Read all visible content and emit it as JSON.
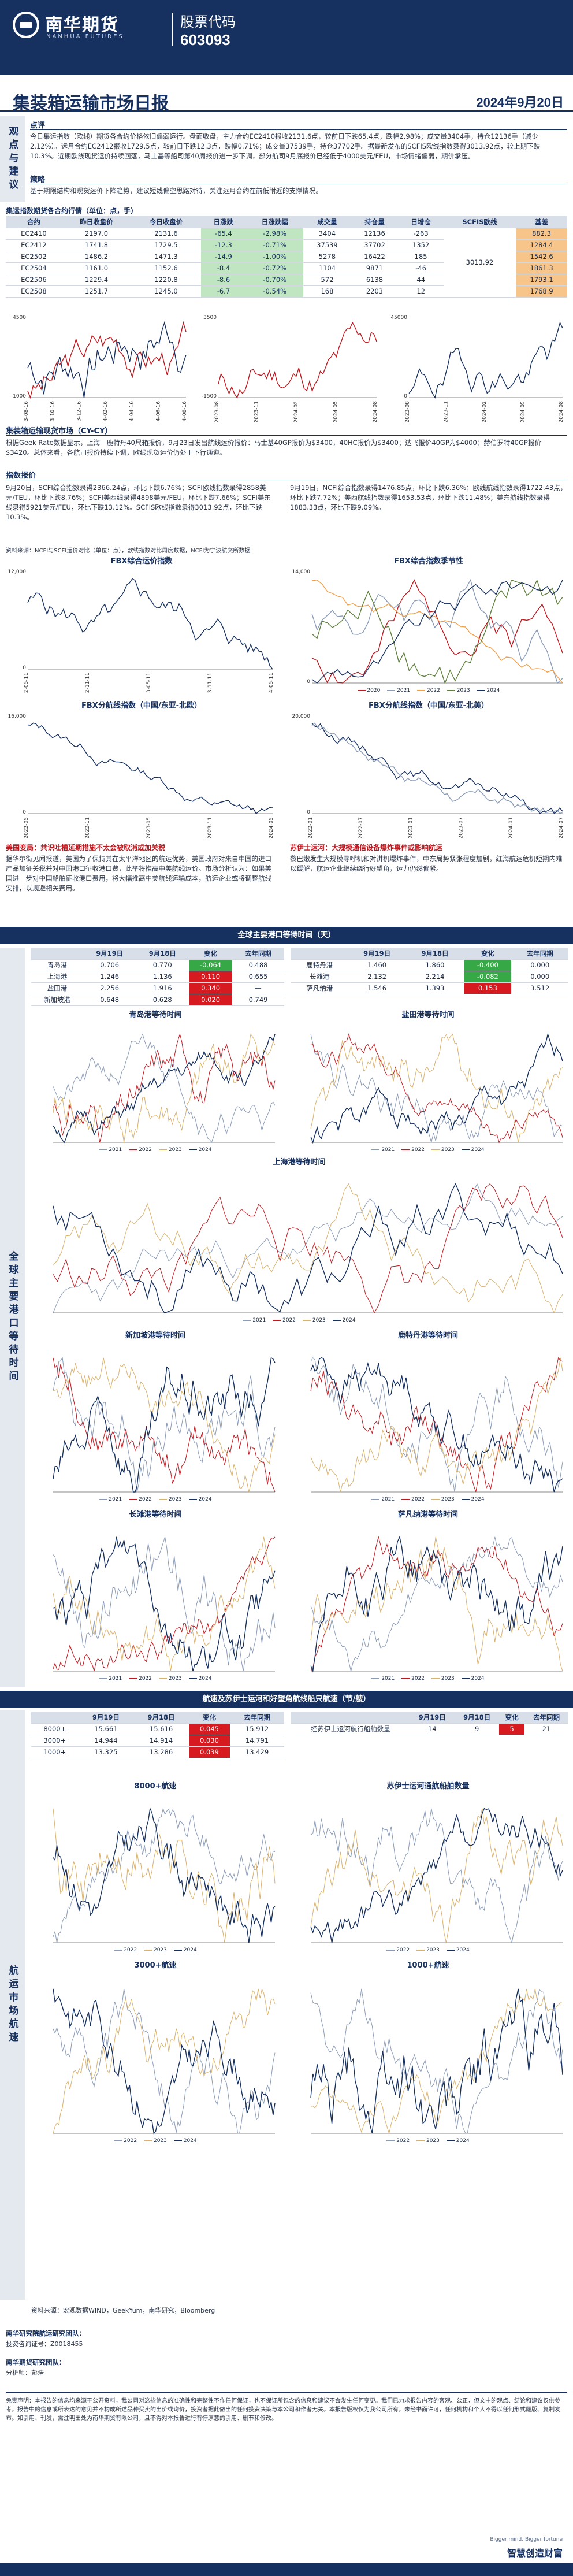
{
  "header": {
    "logo_cn": "南华期货",
    "logo_en": "NANHUA FUTURES",
    "stock_label": "股票代码",
    "stock_code": "603093"
  },
  "report": {
    "title": "集装箱运输市场日报",
    "date": "2024年9月20日"
  },
  "side": {
    "view": "观点与建议",
    "market": "全球主要港口等待时间",
    "ship": "航运市场航速"
  },
  "view": {
    "h1": "点评",
    "p1": "今日集运指数（欧线）期货各合约价格依旧偏弱运行。盘面收盘，主力合约EC2410报收2131.6点，较前日下跌65.4点，跌幅2.98%；成交量3404手，持仓12136手（减少2.12%）。远月合约EC2412报收1729.5点，较前日下跌12.3点，跌幅0.71%；成交量37539手，持仓37702手。据最新发布的SCFIS欧线指数录得3013.92点，较上期下跌10.3%。近期欧线现货运价持续回落，马士基等船司第40周报价进一步下调，部分航司9月底报价已经低于4000美元/FEU，市场情绪偏弱，期价承压。",
    "h2": "策略",
    "p2": "基于期限结构和现货运价下降趋势，建议短线偏空思路对待，关注远月合约在前低附近的支撑情况。"
  },
  "table1": {
    "title": "集运指数期货各合约行情（单位：点，手）",
    "headers": [
      "合约",
      "昨日收盘价",
      "今日收盘价",
      "日涨跌",
      "日涨跌幅",
      "成交量",
      "持仓量",
      "日增仓",
      "SCFIS欧线",
      "基差"
    ],
    "rows": [
      {
        "c": "EC2410",
        "pre": "2197.0",
        "cur": "2131.6",
        "chg": "-65.4",
        "pct": "-2.98%",
        "vol": "3404",
        "oi": "12136",
        "doi": "-263",
        "basis": "882.3"
      },
      {
        "c": "EC2412",
        "pre": "1741.8",
        "cur": "1729.5",
        "chg": "-12.3",
        "pct": "-0.71%",
        "vol": "37539",
        "oi": "37702",
        "doi": "1352",
        "basis": "1284.4"
      },
      {
        "c": "EC2502",
        "pre": "1486.2",
        "cur": "1471.3",
        "chg": "-14.9",
        "pct": "-1.00%",
        "vol": "5278",
        "oi": "16422",
        "doi": "185",
        "basis": "1542.6"
      },
      {
        "c": "EC2504",
        "pre": "1161.0",
        "cur": "1152.6",
        "chg": "-8.4",
        "pct": "-0.72%",
        "vol": "1104",
        "oi": "9871",
        "doi": "-46",
        "basis": "1861.3"
      },
      {
        "c": "EC2506",
        "pre": "1229.4",
        "cur": "1220.8",
        "chg": "-8.6",
        "pct": "-0.70%",
        "vol": "572",
        "oi": "6138",
        "doi": "44",
        "basis": "1793.1"
      },
      {
        "c": "EC2508",
        "pre": "1251.7",
        "cur": "1245.0",
        "chg": "-6.7",
        "pct": "-0.54%",
        "vol": "168",
        "oi": "2203",
        "doi": "12",
        "basis": "1768.9"
      }
    ],
    "scfis": "3013.92"
  },
  "mini1": {
    "title": "EC主力合约收盘价与SCFIS欧线指数",
    "ylabel_max": "4500",
    "ylabel_min": "1000",
    "x": [
      "2023-08-16",
      "2023-10-16",
      "2023-12-16",
      "2024-02-16",
      "2024-04-16",
      "2024-06-16",
      "2024-08-16"
    ]
  },
  "mini2": {
    "title": "EC主力合约基差",
    "ylabel_max": "3500",
    "ylabel_min": "-1500",
    "x": [
      "2023-08",
      "2023-11",
      "2024-02",
      "2024-05",
      "2024-08"
    ]
  },
  "mini3": {
    "title": "EC各合约持仓量",
    "ylabel_max": "45000",
    "ylabel_min": "0",
    "x": [
      "2023-08",
      "2023-11",
      "2024-02",
      "2024-05",
      "2024-08"
    ]
  },
  "cfr": {
    "h": "集装箱运输现货市场（CY-CY）",
    "p": "根据Geek Rate数据显示，上海—鹿特丹40尺箱报价，9月23日发出航线运价报价：马士基40GP报价为$3400，40HC报价为$3400；达飞报价40GP为$4000；赫伯罗特40GP报价$3420。总体来看，各航司报价持续下调，欧线现货运价仍处于下行通道。"
  },
  "index": {
    "h": "指数报价",
    "p1": "9月20日，SCFI综合指数录得2366.24点，环比下跌6.76%；SCFI欧线指数录得2858美元/TEU，环比下跌8.76%；SCFI美西线录得4898美元/FEU，环比下跌7.66%；SCFI美东线录得5921美元/FEU，环比下跌13.12%。SCFIS欧线指数录得3013.92点，环比下跌10.3%。",
    "p2": "9月19日，NCFI综合指数录得1476.85点，环比下跌6.36%；欧线航线指数录得1722.43点，环比下跌7.72%；美西航线指数录得1653.53点，环比下跌11.48%；美东航线指数录得1883.33点，环比下跌9.09%。"
  },
  "src_note": "资料来源：NCFI与SCFI运价对比（单位：点），欧线指数对比周度数据，NCFI为宁波航交所数据",
  "fbx": {
    "c1": {
      "title": "FBX综合运价指数",
      "ymax": "12,000",
      "ymin": "0",
      "x": [
        "2022-05-11",
        "2022-11-11",
        "2023-05-11",
        "2023-11-11",
        "2024-05-11"
      ]
    },
    "c2": {
      "title": "FBX综合指数季节性",
      "ymax": "14,000",
      "ymin": "0",
      "legend": [
        "2020",
        "2021",
        "2022",
        "2023",
        "2024"
      ]
    },
    "c3": {
      "title": "FBX分航线指数（中国/东亚-北欧）",
      "ymax": "16,000",
      "ymin": "0",
      "x": [
        "2022-05",
        "2022-11",
        "2023-05",
        "2023-11",
        "2024-05"
      ]
    },
    "c4": {
      "title": "FBX分航线指数（中国/东亚-北美）",
      "ymax": "20,000",
      "ymin": "0",
      "x": [
        "2022-01",
        "2022-07",
        "2023-01",
        "2023-07",
        "2024-01",
        "2024-07"
      ]
    }
  },
  "news": {
    "h1": "美国变局：共识吐槽延期措施不太会被取消或加关税",
    "p1": "据华尔街见闻报道，美国为了保持其在太平洋地区的航运优势，美国政府对来自中国的进口产品加征关税并对中国港口征收港口费，此举将推高中美航线运价。市场分析认为：如果美国进一步对中国船舶征收港口费用，将大幅推高中美航线运输成本，航运企业或将调整航线安排，以规避相关费用。",
    "h2": "苏伊士运河：大规模通信设备爆炸事件或影响航运",
    "p2": "黎巴嫩发生大规模寻呼机和对讲机爆炸事件，中东局势紧张程度加剧，红海航运危机短期内难以缓解，航运企业继续绕行好望角，运力仍然偏紧。"
  },
  "port": {
    "bar": "全球主要港口等待时间（天）",
    "headers": [
      "",
      "9月19日",
      "9月18日",
      "变化",
      "去年同期"
    ],
    "left": [
      {
        "n": "青岛港",
        "a": "0.706",
        "b": "0.770",
        "c": "-0.064",
        "d": "0.488"
      },
      {
        "n": "上海港",
        "a": "1.246",
        "b": "1.136",
        "c": "0.110",
        "d": "0.655"
      },
      {
        "n": "盐田港",
        "a": "2.256",
        "b": "1.916",
        "c": "0.340",
        "d": "—"
      },
      {
        "n": "新加坡港",
        "a": "0.648",
        "b": "0.628",
        "c": "0.020",
        "d": "0.749"
      }
    ],
    "right": [
      {
        "n": "鹿特丹港",
        "a": "1.460",
        "b": "1.860",
        "c": "-0.400",
        "d": "0.000"
      },
      {
        "n": "长滩港",
        "a": "2.132",
        "b": "2.214",
        "c": "-0.082",
        "d": "0.000"
      },
      {
        "n": "萨凡纳港",
        "a": "1.546",
        "b": "1.393",
        "c": "0.153",
        "d": "3.512"
      }
    ],
    "charts": [
      "青岛港等待时间",
      "盐田港等待时间",
      "上海港等待时间",
      "新加坡港等待时间",
      "鹿特丹港等待时间",
      "长滩港等待时间",
      "萨凡纳港等待时间"
    ],
    "legend": [
      "2021",
      "2022",
      "2023",
      "2024"
    ]
  },
  "speed": {
    "bar": "航速及苏伊士运河和好望角航线船只航速（节/艘）",
    "headers": [
      "",
      "9月19日",
      "9月18日",
      "变化",
      "去年同期"
    ],
    "left": [
      {
        "n": "8000+",
        "a": "15.661",
        "b": "15.616",
        "c": "0.045",
        "d": "15.912"
      },
      {
        "n": "3000+",
        "a": "14.944",
        "b": "14.914",
        "c": "0.030",
        "d": "14.791"
      },
      {
        "n": "1000+",
        "a": "13.325",
        "b": "13.286",
        "c": "0.039",
        "d": "13.429"
      }
    ],
    "right": [
      {
        "n": "经苏伊士运河航行船舶数量",
        "a": "14",
        "b": "9",
        "c": "5",
        "d": "21"
      }
    ],
    "charts": [
      "8000+航速",
      "苏伊士运河通航船舶数量",
      "3000+航速",
      "1000+航速"
    ],
    "legend": [
      "2022",
      "2023",
      "2024"
    ]
  },
  "footer": {
    "source": "资料来源：宏观数据WIND，GeekYum，南华研究，Bloomberg",
    "a1": "南华研究院航运研究团队：",
    "a2": "投资咨询证号：Z0018455",
    "a3": "南华期货研究团队：",
    "a4": "分析师：彭浩",
    "disclaimer": "免责声明：本报告的信息均来源于公开资料，我公司对这些信息的准确性和完整性不作任何保证，也不保证所包含的信息和建议不会发生任何变更。我们已力求报告内容的客观、公正，但文中的观点、结论和建议仅供参考，报告中的信息或所表达的意见并不构成所述品种买卖的出价或询价，投资者据此做出的任何投资决策与本公司和作者无关。本报告版权仅为我公司所有，未经书面许可，任何机构和个人不得以任何形式翻版、复制发布。如引用、刊发，需注明出处为南华期货有限公司，且不得对本报告进行有悖原意的引用、删节和修改。",
    "slogan": "智慧创造财富",
    "slogan_en": "Bigger mind, Bigger fortune"
  }
}
